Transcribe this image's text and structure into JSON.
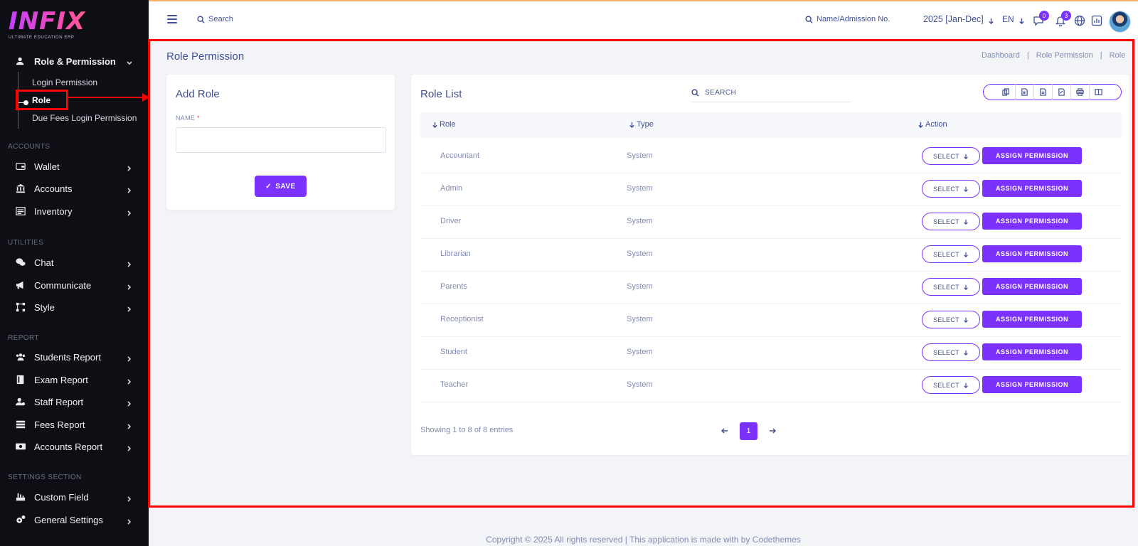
{
  "logo": {
    "word": "INFIX",
    "tagline": "ULTIMATE EDUCATION ERP"
  },
  "sidebar": {
    "role_permission": {
      "label": "Role & Permission",
      "icon": "user-shield-icon"
    },
    "sub_items": [
      "Login Permission",
      "Role",
      "Due Fees Login Permission"
    ],
    "sections": [
      {
        "title": "ACCOUNTS",
        "items": [
          {
            "label": "Wallet",
            "icon": "wallet-icon"
          },
          {
            "label": "Accounts",
            "icon": "bank-icon"
          },
          {
            "label": "Inventory",
            "icon": "inventory-icon"
          }
        ]
      },
      {
        "title": "UTILITIES",
        "items": [
          {
            "label": "Chat",
            "icon": "chat-icon"
          },
          {
            "label": "Communicate",
            "icon": "megaphone-icon"
          },
          {
            "label": "Style",
            "icon": "style-icon"
          }
        ]
      },
      {
        "title": "REPORT",
        "items": [
          {
            "label": "Students Report",
            "icon": "users-icon"
          },
          {
            "label": "Exam Report",
            "icon": "book-icon"
          },
          {
            "label": "Staff Report",
            "icon": "staff-icon"
          },
          {
            "label": "Fees Report",
            "icon": "fees-icon"
          },
          {
            "label": "Accounts Report",
            "icon": "money-icon"
          }
        ]
      },
      {
        "title": "SETTINGS SECTION",
        "items": [
          {
            "label": "Custom Field",
            "icon": "custom-field-icon"
          },
          {
            "label": "General Settings",
            "icon": "gears-icon"
          }
        ]
      }
    ]
  },
  "header": {
    "search_label": "Search",
    "student_search_label": "Name/Admission No.",
    "year": "2025 [Jan-Dec]",
    "lang": "EN",
    "chat_badge": "0",
    "notification_badge": "3"
  },
  "page": {
    "title": "Role Permission",
    "breadcrumb": [
      "Dashboard",
      "Role Permission",
      "Role"
    ]
  },
  "add_role": {
    "title": "Add Role",
    "name_label": "NAME",
    "required_mark": "*",
    "name_value": "",
    "save_label": "SAVE"
  },
  "role_list": {
    "title": "Role List",
    "search_label": "SEARCH",
    "columns": [
      "Role",
      "Type",
      "Action"
    ],
    "rows": [
      {
        "role": "Accountant",
        "type": "System"
      },
      {
        "role": "Admin",
        "type": "System"
      },
      {
        "role": "Driver",
        "type": "System"
      },
      {
        "role": "Librarian",
        "type": "System"
      },
      {
        "role": "Parents",
        "type": "System"
      },
      {
        "role": "Receptionist",
        "type": "System"
      },
      {
        "role": "Student",
        "type": "System"
      },
      {
        "role": "Teacher",
        "type": "System"
      }
    ],
    "select_label": "SELECT",
    "assign_label": "ASSIGN PERMISSION",
    "entries_text": "Showing 1 to 8 of 8 entries",
    "current_page": "1",
    "export_icons": [
      "copy-icon",
      "excel-icon",
      "csv-icon",
      "pdf-icon",
      "print-icon",
      "columns-icon"
    ]
  },
  "footer": {
    "text": "Copyright © 2025 All rights reserved | This application is made with by Codethemes"
  },
  "colors": {
    "accent": "#7c32ff",
    "sidebar_bg": "#0e0f14",
    "text": "#415094",
    "highlight": "#ff0000"
  }
}
